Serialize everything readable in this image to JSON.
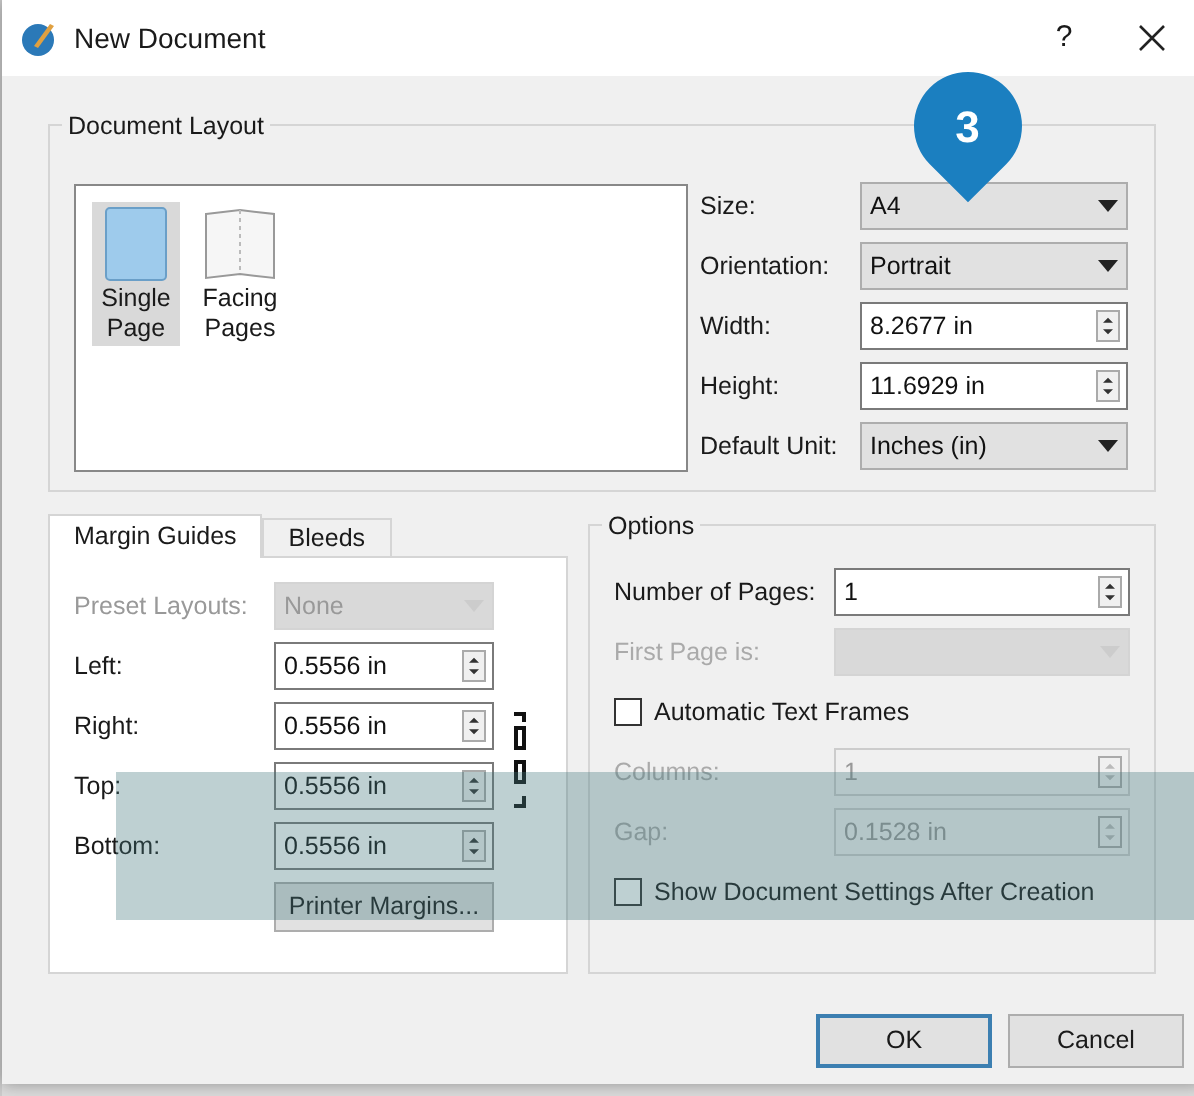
{
  "window": {
    "title": "New Document",
    "help": "?"
  },
  "callout": {
    "number": "3"
  },
  "document_layout": {
    "title": "Document Layout",
    "layouts": [
      {
        "label": "Single Page",
        "kind": "single",
        "selected": true
      },
      {
        "label": "Facing Pages",
        "kind": "facing",
        "selected": false
      }
    ],
    "fields": [
      {
        "label": "Size:",
        "kind": "select",
        "value": "A4"
      },
      {
        "label": "Orientation:",
        "kind": "select",
        "value": "Portrait"
      },
      {
        "label": "Width:",
        "kind": "spin",
        "value": "8.2677 in"
      },
      {
        "label": "Height:",
        "kind": "spin",
        "value": "11.6929 in"
      },
      {
        "label": "Default Unit:",
        "kind": "select",
        "value": "Inches (in)"
      }
    ]
  },
  "margins": {
    "tabs": [
      {
        "label": "Margin Guides",
        "selected": true
      },
      {
        "label": "Bleeds",
        "selected": false
      }
    ],
    "fields": [
      {
        "label": "Preset Layouts:",
        "kind": "select",
        "value": "None",
        "disabled": true
      },
      {
        "label": "Left:",
        "kind": "spin",
        "value": "0.5556 in",
        "disabled": false
      },
      {
        "label": "Right:",
        "kind": "spin",
        "value": "0.5556 in",
        "disabled": false
      },
      {
        "label": "Top:",
        "kind": "spin",
        "value": "0.5556 in",
        "disabled": false
      },
      {
        "label": "Bottom:",
        "kind": "spin",
        "value": "0.5556 in",
        "disabled": false
      }
    ],
    "printer_button": "Printer Margins..."
  },
  "options": {
    "title": "Options",
    "items": [
      {
        "kind": "spin",
        "label": "Number of Pages:",
        "value": "1",
        "disabled": false
      },
      {
        "kind": "select",
        "label": "First Page is:",
        "disabled": true
      },
      {
        "kind": "checkbox",
        "label": "Automatic Text Frames",
        "checked": false
      },
      {
        "kind": "spin",
        "label": "Columns:",
        "value": "1",
        "disabled": true
      },
      {
        "kind": "spin",
        "label": "Gap:",
        "value": "0.1528 in",
        "disabled": true
      },
      {
        "kind": "checkbox",
        "label": "Show Document Settings After Creation",
        "checked": false
      }
    ]
  },
  "buttons": [
    {
      "label": "OK",
      "default": true
    },
    {
      "label": "Cancel",
      "default": false
    }
  ]
}
